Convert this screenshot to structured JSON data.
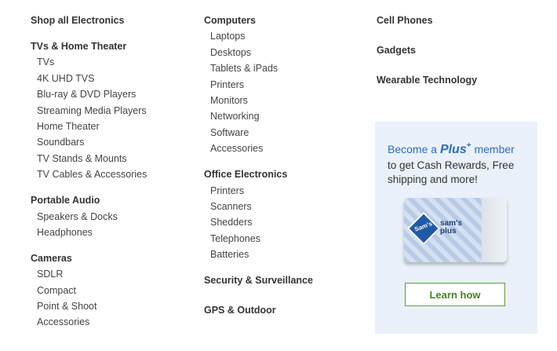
{
  "col1": {
    "shop_all": "Shop all Electronics",
    "groups": [
      {
        "heading": "TVs & Home Theater",
        "items": [
          "TVs",
          "4K UHD TVS",
          "Blu-ray & DVD Players",
          "Streaming Media Players",
          "Home Theater",
          "Soundbars",
          "TV Stands & Mounts",
          "TV Cables & Accessories"
        ]
      },
      {
        "heading": "Portable Audio",
        "items": [
          "Speakers & Docks",
          "Headphones"
        ]
      },
      {
        "heading": "Cameras",
        "items": [
          "SDLR",
          "Compact",
          "Point & Shoot",
          "Accessories"
        ]
      }
    ]
  },
  "col2": {
    "groups": [
      {
        "heading": "Computers",
        "items": [
          "Laptops",
          "Desktops",
          "Tablets & iPads",
          "Printers",
          "Monitors",
          "Networking",
          "Software",
          "Accessories"
        ]
      },
      {
        "heading": "Office Electronics",
        "items": [
          "Printers",
          "Scanners",
          "Shedders",
          "Telephones",
          "Batteries"
        ]
      }
    ],
    "security": "Security & Surveillance",
    "gps": "GPS & Outdoor"
  },
  "col3": {
    "cell_phones": "Cell Phones",
    "gadgets": "Gadgets",
    "wearable": "Wearable Technology"
  },
  "promo": {
    "become_a": "Become a",
    "plus": "Plus",
    "plus_sup": "+",
    "member": "member",
    "text": "to get Cash Rewards, Free shipping and more!",
    "card_logo": "Sam's",
    "card_brand_line1": "sam's",
    "card_brand_line2": "plus",
    "button": "Learn how"
  },
  "colors": {
    "accent_blue": "#2a6ebb",
    "button_green": "#3c8a1b",
    "promo_bg": "#eaf1fa"
  }
}
